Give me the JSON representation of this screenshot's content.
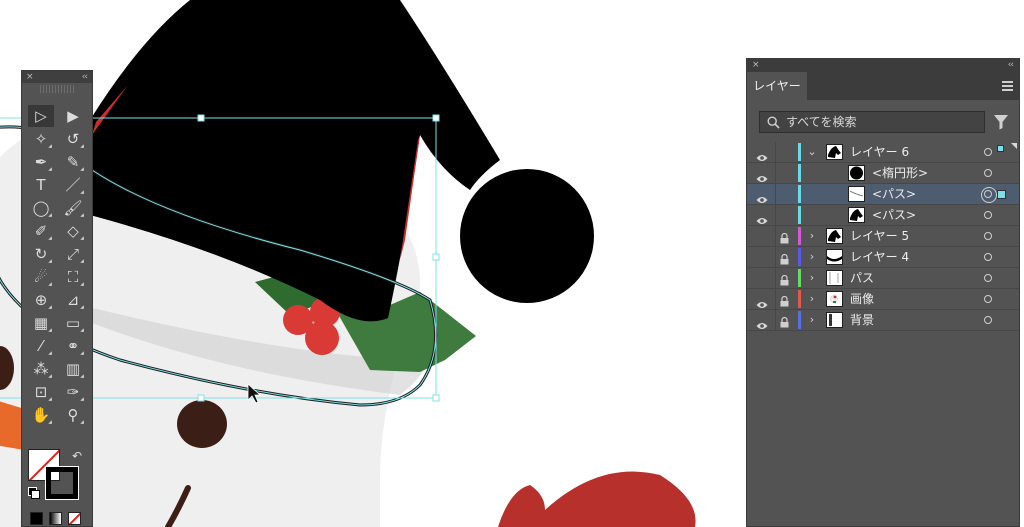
{
  "colors": {
    "panel_bg": "#535353",
    "panel_dark": "#3c3c3c",
    "selection_cyan": "#7de0e8",
    "hat": "#000000",
    "berry": "#d93a35",
    "holly": "#3f7a3e",
    "mitten": "#b8302b"
  },
  "tools_panel": {
    "close_glyph": "×",
    "collapse_glyph": "‹‹",
    "tools": [
      {
        "name": "selection-tool-icon",
        "glyph": "▷",
        "selected": true
      },
      {
        "name": "direct-selection-tool-icon",
        "glyph": "▶",
        "selected": false
      },
      {
        "name": "magic-wand-tool-icon",
        "glyph": "✧",
        "selected": false
      },
      {
        "name": "lasso-tool-icon",
        "glyph": "↺",
        "selected": false
      },
      {
        "name": "pen-tool-icon",
        "glyph": "✒",
        "selected": false
      },
      {
        "name": "curvature-tool-icon",
        "glyph": "✎",
        "selected": false
      },
      {
        "name": "type-tool-icon",
        "glyph": "T",
        "selected": false
      },
      {
        "name": "line-segment-tool-icon",
        "glyph": "／",
        "selected": false
      },
      {
        "name": "ellipse-tool-icon",
        "glyph": "◯",
        "selected": false
      },
      {
        "name": "paintbrush-tool-icon",
        "glyph": "🖌",
        "selected": false
      },
      {
        "name": "shaper-tool-icon",
        "glyph": "✐",
        "selected": false
      },
      {
        "name": "eraser-tool-icon",
        "glyph": "◇",
        "selected": false
      },
      {
        "name": "rotate-tool-icon",
        "glyph": "↻",
        "selected": false
      },
      {
        "name": "scale-tool-icon",
        "glyph": "⤢",
        "selected": false
      },
      {
        "name": "warp-tool-icon",
        "glyph": "☄",
        "selected": false
      },
      {
        "name": "free-transform-tool-icon",
        "glyph": "⛶",
        "selected": false
      },
      {
        "name": "shape-builder-tool-icon",
        "glyph": "⊕",
        "selected": false
      },
      {
        "name": "perspective-grid-tool-icon",
        "glyph": "⊿",
        "selected": false
      },
      {
        "name": "mesh-tool-icon",
        "glyph": "▦",
        "selected": false
      },
      {
        "name": "gradient-tool-icon",
        "glyph": "▭",
        "selected": false
      },
      {
        "name": "eyedropper-tool-icon",
        "glyph": "⁄",
        "selected": false
      },
      {
        "name": "blend-tool-icon",
        "glyph": "⚭",
        "selected": false
      },
      {
        "name": "symbol-sprayer-tool-icon",
        "glyph": "⁂",
        "selected": false
      },
      {
        "name": "column-graph-tool-icon",
        "glyph": "▥",
        "selected": false
      },
      {
        "name": "artboard-tool-icon",
        "glyph": "⊡",
        "selected": false
      },
      {
        "name": "slice-tool-icon",
        "glyph": "✑",
        "selected": false
      },
      {
        "name": "hand-tool-icon",
        "glyph": "✋",
        "selected": false
      },
      {
        "name": "zoom-tool-icon",
        "glyph": "⚲",
        "selected": false
      }
    ]
  },
  "layers_panel": {
    "close_glyph": "×",
    "collapse_glyph": "‹‹",
    "tab_label": "レイヤー",
    "search_placeholder": "すべてを検索",
    "rows": [
      {
        "name": "レイヤー 6",
        "level": 0,
        "visible": true,
        "locked": false,
        "expanded": true,
        "has_chevron": true,
        "color": "#6fd8e6",
        "thumb": "hat",
        "selected": false,
        "targeted": false,
        "sel_mark": "small",
        "corner": true
      },
      {
        "name": "<楕円形>",
        "level": 1,
        "visible": true,
        "locked": false,
        "expanded": false,
        "has_chevron": false,
        "color": "#6fd8e6",
        "thumb": "circle",
        "selected": false,
        "targeted": false,
        "sel_mark": "none",
        "corner": false
      },
      {
        "name": "<パス>",
        "level": 1,
        "visible": true,
        "locked": false,
        "expanded": false,
        "has_chevron": false,
        "color": "#6fd8e6",
        "thumb": "stroke",
        "selected": true,
        "targeted": true,
        "sel_mark": "big",
        "corner": false
      },
      {
        "name": "<パス>",
        "level": 1,
        "visible": true,
        "locked": false,
        "expanded": false,
        "has_chevron": false,
        "color": "#6fd8e6",
        "thumb": "hat",
        "selected": false,
        "targeted": false,
        "sel_mark": "none",
        "corner": false
      },
      {
        "name": "レイヤー 5",
        "level": 0,
        "visible": false,
        "locked": true,
        "expanded": false,
        "has_chevron": true,
        "color": "#d25ad8",
        "thumb": "hat",
        "selected": false,
        "targeted": false,
        "sel_mark": "none",
        "corner": false
      },
      {
        "name": "レイヤー 4",
        "level": 0,
        "visible": false,
        "locked": true,
        "expanded": false,
        "has_chevron": true,
        "color": "#5a5ae8",
        "thumb": "band",
        "selected": false,
        "targeted": false,
        "sel_mark": "none",
        "corner": false
      },
      {
        "name": "パス",
        "level": 0,
        "visible": false,
        "locked": true,
        "expanded": false,
        "has_chevron": true,
        "color": "#67d86a",
        "thumb": "lines",
        "selected": false,
        "targeted": false,
        "sel_mark": "none",
        "corner": false
      },
      {
        "name": "画像",
        "level": 0,
        "visible": true,
        "locked": true,
        "expanded": false,
        "has_chevron": true,
        "color": "#e05a4a",
        "thumb": "image",
        "selected": false,
        "targeted": false,
        "sel_mark": "none",
        "corner": false
      },
      {
        "name": "背景",
        "level": 0,
        "visible": true,
        "locked": true,
        "expanded": false,
        "has_chevron": true,
        "color": "#5a6ee0",
        "thumb": "bg",
        "selected": false,
        "targeted": false,
        "sel_mark": "none",
        "corner": false
      }
    ]
  }
}
